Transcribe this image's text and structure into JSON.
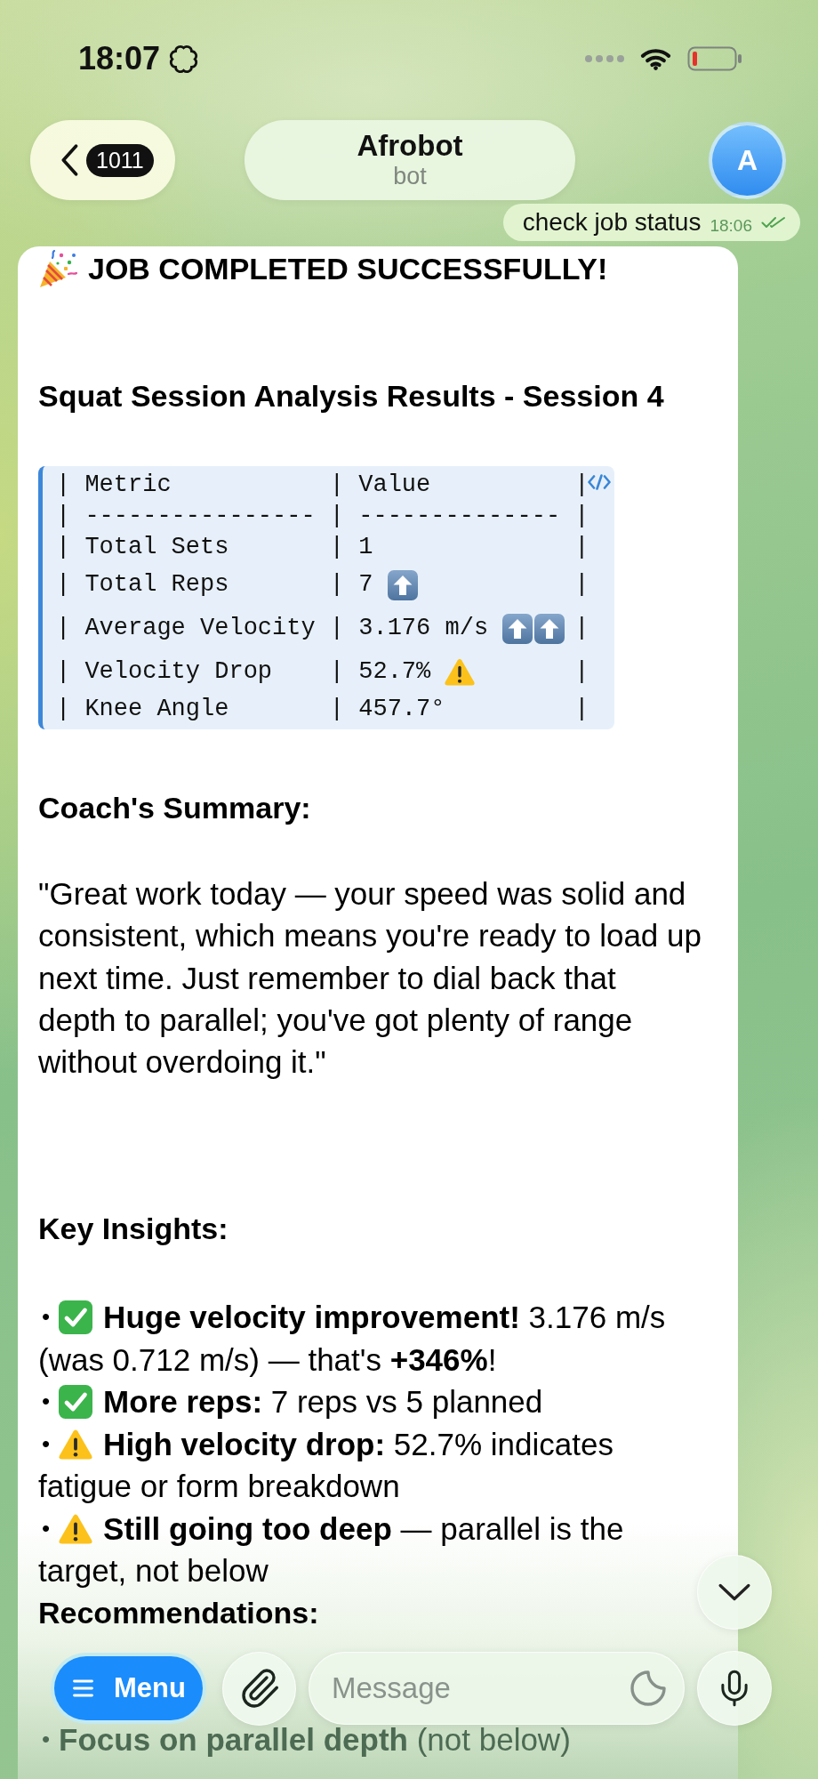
{
  "status_bar": {
    "time": "18:07"
  },
  "header": {
    "back_badge": "1011",
    "title": "Afrobot",
    "subtitle": "bot",
    "avatar_letter": "A"
  },
  "outgoing_message": {
    "text": "check job status",
    "time": "18:06",
    "read": true
  },
  "message": {
    "title": "JOB COMPLETED SUCCESSFULLY!",
    "heading": "Squat Session Analysis Results - Session 4",
    "code_table": {
      "rows": [
        {
          "text": "| Metric           | Value          |"
        },
        {
          "text": "| ---------------- | -------------- |"
        },
        {
          "text": "| Total Sets       | 1              |"
        },
        {
          "text": "| Total Reps       | 7",
          "marks": [
            {
              "kind": "up"
            }
          ],
          "end": "|"
        },
        {
          "text": "| Average Velocity | 3.176 m/s",
          "marks": [
            {
              "kind": "up"
            },
            {
              "kind": "up"
            }
          ],
          "end": "|"
        },
        {
          "text": "| Velocity Drop    | 52.7%",
          "marks": [
            {
              "kind": "warning"
            }
          ],
          "end": "|"
        },
        {
          "text": "| Knee Angle       | 457.7°         |"
        }
      ]
    },
    "summary_heading": "Coach's Summary:",
    "summary": "\"Great work today — your speed was solid and\nconsistent, which means you're ready to load up\nnext time. Just remember to dial back that\ndepth to parallel; you've got plenty of range\nwithout overdoing it.\"",
    "insights_heading": "Key Insights:",
    "insights": [
      {
        "bullet": "•",
        "kind": "check",
        "lines": [
          "**Huge velocity improvement!** 3.176 m/s",
          "(was 0.712 m/s) — that's **+346%**!"
        ]
      },
      {
        "bullet": "•",
        "kind": "check",
        "lines": [
          "**More reps:** 7 reps vs 5 planned"
        ]
      },
      {
        "bullet": "•",
        "kind": "warning",
        "lines": [
          "**High velocity drop:** 52.7% indicates",
          "fatigue or form breakdown"
        ]
      },
      {
        "bullet": "•",
        "kind": "warning",
        "lines": [
          "**Still going too deep** — parallel is the",
          "target, not below"
        ]
      }
    ],
    "recommendations_heading": "Recommendations:",
    "recommendations": [
      {
        "bullet": "•",
        "lines": [
          "**Focus on parallel depth** (not below)"
        ]
      }
    ]
  },
  "composer": {
    "menu_label": "Menu",
    "placeholder": "Message"
  }
}
